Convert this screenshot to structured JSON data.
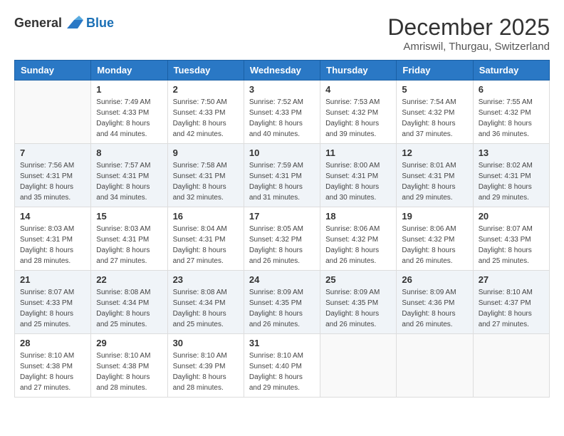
{
  "logo": {
    "general": "General",
    "blue": "Blue"
  },
  "title": "December 2025",
  "location": "Amriswil, Thurgau, Switzerland",
  "weekdays": [
    "Sunday",
    "Monday",
    "Tuesday",
    "Wednesday",
    "Thursday",
    "Friday",
    "Saturday"
  ],
  "weeks": [
    [
      {
        "day": "",
        "sunrise": "",
        "sunset": "",
        "daylight": ""
      },
      {
        "day": "1",
        "sunrise": "Sunrise: 7:49 AM",
        "sunset": "Sunset: 4:33 PM",
        "daylight": "Daylight: 8 hours and 44 minutes."
      },
      {
        "day": "2",
        "sunrise": "Sunrise: 7:50 AM",
        "sunset": "Sunset: 4:33 PM",
        "daylight": "Daylight: 8 hours and 42 minutes."
      },
      {
        "day": "3",
        "sunrise": "Sunrise: 7:52 AM",
        "sunset": "Sunset: 4:33 PM",
        "daylight": "Daylight: 8 hours and 40 minutes."
      },
      {
        "day": "4",
        "sunrise": "Sunrise: 7:53 AM",
        "sunset": "Sunset: 4:32 PM",
        "daylight": "Daylight: 8 hours and 39 minutes."
      },
      {
        "day": "5",
        "sunrise": "Sunrise: 7:54 AM",
        "sunset": "Sunset: 4:32 PM",
        "daylight": "Daylight: 8 hours and 37 minutes."
      },
      {
        "day": "6",
        "sunrise": "Sunrise: 7:55 AM",
        "sunset": "Sunset: 4:32 PM",
        "daylight": "Daylight: 8 hours and 36 minutes."
      }
    ],
    [
      {
        "day": "7",
        "sunrise": "Sunrise: 7:56 AM",
        "sunset": "Sunset: 4:31 PM",
        "daylight": "Daylight: 8 hours and 35 minutes."
      },
      {
        "day": "8",
        "sunrise": "Sunrise: 7:57 AM",
        "sunset": "Sunset: 4:31 PM",
        "daylight": "Daylight: 8 hours and 34 minutes."
      },
      {
        "day": "9",
        "sunrise": "Sunrise: 7:58 AM",
        "sunset": "Sunset: 4:31 PM",
        "daylight": "Daylight: 8 hours and 32 minutes."
      },
      {
        "day": "10",
        "sunrise": "Sunrise: 7:59 AM",
        "sunset": "Sunset: 4:31 PM",
        "daylight": "Daylight: 8 hours and 31 minutes."
      },
      {
        "day": "11",
        "sunrise": "Sunrise: 8:00 AM",
        "sunset": "Sunset: 4:31 PM",
        "daylight": "Daylight: 8 hours and 30 minutes."
      },
      {
        "day": "12",
        "sunrise": "Sunrise: 8:01 AM",
        "sunset": "Sunset: 4:31 PM",
        "daylight": "Daylight: 8 hours and 29 minutes."
      },
      {
        "day": "13",
        "sunrise": "Sunrise: 8:02 AM",
        "sunset": "Sunset: 4:31 PM",
        "daylight": "Daylight: 8 hours and 29 minutes."
      }
    ],
    [
      {
        "day": "14",
        "sunrise": "Sunrise: 8:03 AM",
        "sunset": "Sunset: 4:31 PM",
        "daylight": "Daylight: 8 hours and 28 minutes."
      },
      {
        "day": "15",
        "sunrise": "Sunrise: 8:03 AM",
        "sunset": "Sunset: 4:31 PM",
        "daylight": "Daylight: 8 hours and 27 minutes."
      },
      {
        "day": "16",
        "sunrise": "Sunrise: 8:04 AM",
        "sunset": "Sunset: 4:31 PM",
        "daylight": "Daylight: 8 hours and 27 minutes."
      },
      {
        "day": "17",
        "sunrise": "Sunrise: 8:05 AM",
        "sunset": "Sunset: 4:32 PM",
        "daylight": "Daylight: 8 hours and 26 minutes."
      },
      {
        "day": "18",
        "sunrise": "Sunrise: 8:06 AM",
        "sunset": "Sunset: 4:32 PM",
        "daylight": "Daylight: 8 hours and 26 minutes."
      },
      {
        "day": "19",
        "sunrise": "Sunrise: 8:06 AM",
        "sunset": "Sunset: 4:32 PM",
        "daylight": "Daylight: 8 hours and 26 minutes."
      },
      {
        "day": "20",
        "sunrise": "Sunrise: 8:07 AM",
        "sunset": "Sunset: 4:33 PM",
        "daylight": "Daylight: 8 hours and 25 minutes."
      }
    ],
    [
      {
        "day": "21",
        "sunrise": "Sunrise: 8:07 AM",
        "sunset": "Sunset: 4:33 PM",
        "daylight": "Daylight: 8 hours and 25 minutes."
      },
      {
        "day": "22",
        "sunrise": "Sunrise: 8:08 AM",
        "sunset": "Sunset: 4:34 PM",
        "daylight": "Daylight: 8 hours and 25 minutes."
      },
      {
        "day": "23",
        "sunrise": "Sunrise: 8:08 AM",
        "sunset": "Sunset: 4:34 PM",
        "daylight": "Daylight: 8 hours and 25 minutes."
      },
      {
        "day": "24",
        "sunrise": "Sunrise: 8:09 AM",
        "sunset": "Sunset: 4:35 PM",
        "daylight": "Daylight: 8 hours and 26 minutes."
      },
      {
        "day": "25",
        "sunrise": "Sunrise: 8:09 AM",
        "sunset": "Sunset: 4:35 PM",
        "daylight": "Daylight: 8 hours and 26 minutes."
      },
      {
        "day": "26",
        "sunrise": "Sunrise: 8:09 AM",
        "sunset": "Sunset: 4:36 PM",
        "daylight": "Daylight: 8 hours and 26 minutes."
      },
      {
        "day": "27",
        "sunrise": "Sunrise: 8:10 AM",
        "sunset": "Sunset: 4:37 PM",
        "daylight": "Daylight: 8 hours and 27 minutes."
      }
    ],
    [
      {
        "day": "28",
        "sunrise": "Sunrise: 8:10 AM",
        "sunset": "Sunset: 4:38 PM",
        "daylight": "Daylight: 8 hours and 27 minutes."
      },
      {
        "day": "29",
        "sunrise": "Sunrise: 8:10 AM",
        "sunset": "Sunset: 4:38 PM",
        "daylight": "Daylight: 8 hours and 28 minutes."
      },
      {
        "day": "30",
        "sunrise": "Sunrise: 8:10 AM",
        "sunset": "Sunset: 4:39 PM",
        "daylight": "Daylight: 8 hours and 28 minutes."
      },
      {
        "day": "31",
        "sunrise": "Sunrise: 8:10 AM",
        "sunset": "Sunset: 4:40 PM",
        "daylight": "Daylight: 8 hours and 29 minutes."
      },
      {
        "day": "",
        "sunrise": "",
        "sunset": "",
        "daylight": ""
      },
      {
        "day": "",
        "sunrise": "",
        "sunset": "",
        "daylight": ""
      },
      {
        "day": "",
        "sunrise": "",
        "sunset": "",
        "daylight": ""
      }
    ]
  ]
}
